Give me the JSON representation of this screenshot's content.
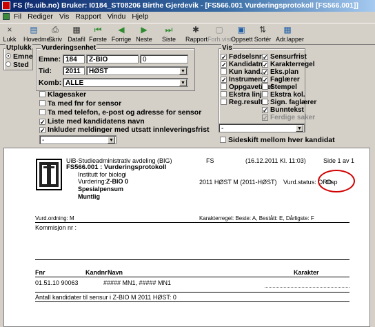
{
  "window": {
    "title": "FS (fs.uib.no) Bruker: I0184_ST08206 Birthe Gjerdevik - [FS566.001 Vurderingsprotokoll [FS566.001]]"
  },
  "menu": {
    "items": [
      "Fil",
      "Rediger",
      "Vis",
      "Rapport",
      "Vindu",
      "Hjelp"
    ]
  },
  "toolbar": {
    "buttons": [
      {
        "label": "Lukk",
        "icon": "close-icon",
        "glyph": "×",
        "enabled": true
      },
      {
        "label": "Hovedme...",
        "icon": "main-menu-icon",
        "glyph": "▤",
        "enabled": true
      },
      {
        "label": "Skriv",
        "icon": "printer-icon",
        "glyph": "⎙",
        "enabled": true
      },
      {
        "label": "Datafil",
        "icon": "save-icon",
        "glyph": "▦",
        "enabled": true
      },
      {
        "label": "Første",
        "icon": "first-icon",
        "glyph": "⏮",
        "enabled": true
      },
      {
        "label": "Forrige",
        "icon": "previous-icon",
        "glyph": "◀",
        "enabled": true
      },
      {
        "label": "Neste",
        "icon": "next-icon",
        "glyph": "▶",
        "enabled": true
      },
      {
        "label": "Siste",
        "icon": "last-icon",
        "glyph": "⏭",
        "enabled": true
      },
      {
        "label": "Rapport",
        "icon": "report-icon",
        "glyph": "✱",
        "enabled": true
      },
      {
        "label": "Forh.visn.",
        "icon": "preview-icon",
        "glyph": "▢",
        "enabled": false
      },
      {
        "label": "Oppsett",
        "icon": "setup-icon",
        "glyph": "▣",
        "enabled": true
      },
      {
        "label": "Sortér",
        "icon": "sort-icon",
        "glyph": "⇅",
        "enabled": true
      },
      {
        "label": "Adr.lapper",
        "icon": "address-labels-icon",
        "glyph": "▦",
        "enabled": true
      }
    ]
  },
  "utplukk": {
    "title": "Utplukk",
    "options": [
      "Emne",
      "Sted"
    ],
    "selected": "Emne"
  },
  "vurderingsenhet": {
    "title": "Vurderingsenhet",
    "emne_label": "Emne:",
    "emne_code": "184",
    "emne_name": "Z-BIO",
    "emne_num": "0",
    "tid_label": "Tid:",
    "tid_year": "2011",
    "tid_term": "HØST",
    "komb_label": "Komb:",
    "komb_value": "ALLE"
  },
  "options": [
    {
      "label": "Klagesaker",
      "checked": false
    },
    {
      "label": "Ta med fnr for sensor",
      "checked": false
    },
    {
      "label": "Ta med telefon, e-post og adresse  for sensor",
      "checked": false
    },
    {
      "label": "Liste med kandidatens navn",
      "checked": true
    },
    {
      "label": "Inkluder meldinger med utsatt innleveringsfrist",
      "checked": true
    }
  ],
  "left_dropdown": {
    "value": "-"
  },
  "vis": {
    "title": "Vis",
    "col1": [
      {
        "label": "Fødselsnr",
        "checked": true
      },
      {
        "label": "Kandidatnr",
        "checked": true
      },
      {
        "label": "Kun kand.",
        "checked": false
      },
      {
        "label": "Instrument",
        "checked": true
      },
      {
        "label": "Oppgavetittel",
        "checked": false
      },
      {
        "label": "Ekstra linjer",
        "checked": false
      },
      {
        "label": "Reg.resultat",
        "checked": false
      }
    ],
    "col2": [
      {
        "label": "Sensurfrist",
        "checked": true
      },
      {
        "label": "Karakterregel",
        "checked": true
      },
      {
        "label": "Eks.plan",
        "checked": true
      },
      {
        "label": "Faglærer",
        "checked": true
      },
      {
        "label": "Stempel",
        "checked": false
      },
      {
        "label": "Ekstra kol.",
        "checked": false
      },
      {
        "label": "Sign. faglærer",
        "checked": false
      },
      {
        "label": "Bunntekst",
        "checked": true
      },
      {
        "label": "Ferdige saker",
        "checked": true,
        "disabled": true
      }
    ],
    "dropdown_value": "-",
    "sideskift_label": "Sideskift mellom hver kandidat",
    "sideskift_checked": false
  },
  "report": {
    "org": "UiB-Studieadministrativ avdeling (BIG)",
    "system": "FS",
    "datetime": "(16.12.2011 Kl. 11:03)",
    "page": "Side 1 av 1",
    "title": "FS566.001 : Vurderingsprotokoll",
    "institute": "Institutt for biologi",
    "vurdering_label": "Vurdering:",
    "vurdering_value": "Z-BIO 0",
    "term_info": "2011 HØST M (2011-HØST)",
    "vurd_status": "Vurd.status: ORD",
    "osp": "Osp",
    "pensum": "Spesialpensum",
    "form": "Muntlig",
    "vurdordning": "Vurd.ordning: M",
    "karakterregel": "Karakterregel: Beste: A, Bestått: E, Dårligste: F",
    "kommisjon": "Kommisjon nr   :",
    "col_fnr": "Fnr",
    "col_kandnr": "Kandnr",
    "col_navn": "Navn",
    "col_karakter": "Karakter",
    "row_fnr": "01.51.10 90063",
    "row_navn": "##### MN1, ##### MN1",
    "footer": "Antall kandidater til sensur i Z-BIO M 2011 HØST: 0"
  },
  "annotation_color": "#d00000"
}
